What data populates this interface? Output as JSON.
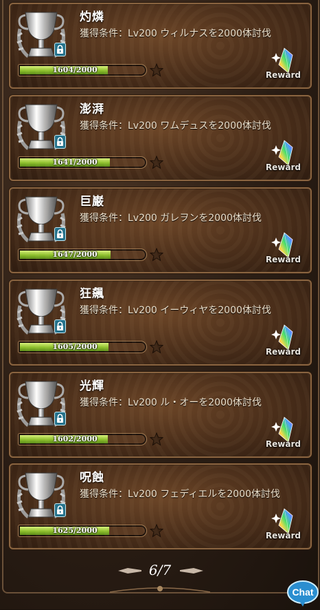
{
  "cards": [
    {
      "title": "灼燐",
      "condition": "獲得条件：Lv200 ウィルナスを2000体討伐",
      "progress_text": "1604/2000",
      "progress": 0.802,
      "reward": "Reward"
    },
    {
      "title": "澎湃",
      "condition": "獲得条件：Lv200 ワムデュスを2000体討伐",
      "progress_text": "1641/2000",
      "progress": 0.8205,
      "reward": "Reward"
    },
    {
      "title": "巨巌",
      "condition": "獲得条件：Lv200 ガレヲンを2000体討伐",
      "progress_text": "1647/2000",
      "progress": 0.8235,
      "reward": "Reward"
    },
    {
      "title": "狂飆",
      "condition": "獲得条件：Lv200 イーウィヤを2000体討伐",
      "progress_text": "1605/2000",
      "progress": 0.8025,
      "reward": "Reward"
    },
    {
      "title": "光輝",
      "condition": "獲得条件：Lv200 ル・オーを2000体討伐",
      "progress_text": "1602/2000",
      "progress": 0.801,
      "reward": "Reward"
    },
    {
      "title": "呪蝕",
      "condition": "獲得条件：Lv200 フェディエルを2000体討伐",
      "progress_text": "1625/2000",
      "progress": 0.8125,
      "reward": "Reward"
    }
  ],
  "pager": {
    "text": "6/7"
  },
  "chat": {
    "label": "Chat"
  },
  "icons": {
    "trophy": "silver-trophy-icon",
    "lock": "lock-icon",
    "star": "star-icon",
    "reward": "rainbow-crystal-icon"
  },
  "colors": {
    "bar_fill": "#8cbf2c",
    "card_border": "#8a6440",
    "lock_bg": "#1f6f8a",
    "chat_blue": "#2a8ed0"
  }
}
